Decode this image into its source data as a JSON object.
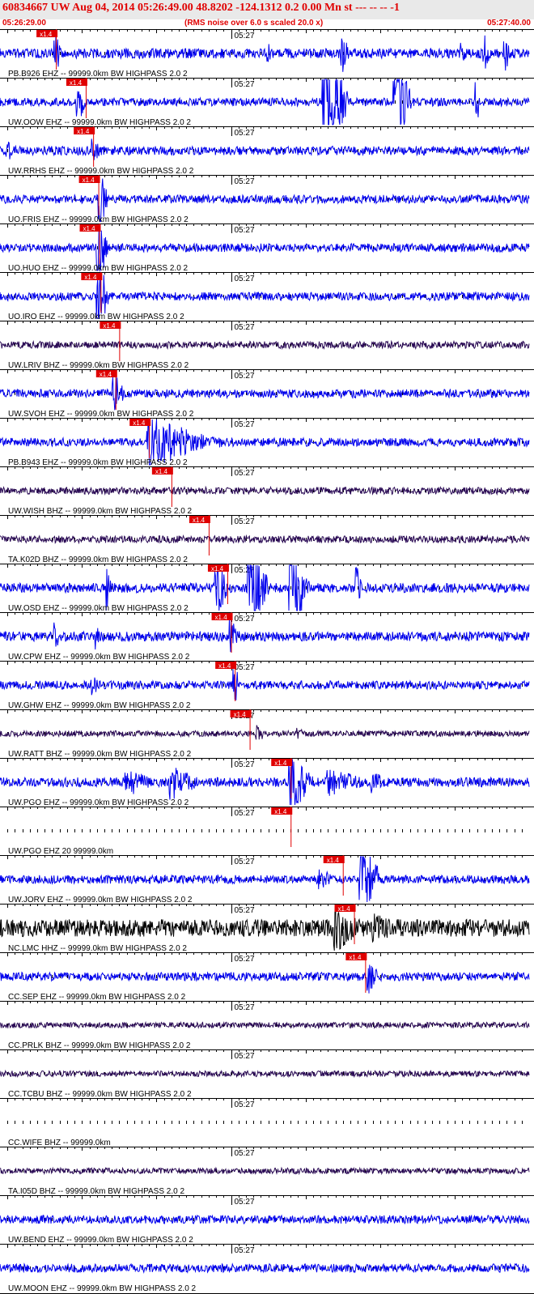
{
  "header": {
    "title": "60834667 UW Aug 04, 2014 05:26:49.00   48.8202 -124.1312  0.2 0.00 Mn st --- -- --  -1",
    "start_time": "05:26:29.00",
    "noise_note": "(RMS noise over 6.0 s scaled 20.0 x)",
    "end_time": "05:27:40.00"
  },
  "chart_data": {
    "type": "line",
    "title": "60834667 UW Aug 04, 2014 05:26:49.00   48.8202 -124.1312  0.2 0.00 Mn st --- -- --  -1",
    "x_range": [
      "05:26:29.00",
      "05:27:40.00"
    ],
    "tick_label": "05:27",
    "pick_label": "x1.4",
    "colors": {
      "trace_blue": "#0000ee",
      "trace_purple": "#2a0a55",
      "trace_black": "#000000",
      "pick": "#e00000",
      "title": "#e00000"
    },
    "traces": [
      {
        "label": "PB.B926 EHZ -- 99999.0km BW  HIGHPASS  2.0  2",
        "color": "#0000ee",
        "pick": 7.5,
        "amp": 0.35,
        "noise": 0.15,
        "bursts": [
          [
            7.5,
            0.8,
            1.0
          ],
          [
            36,
            0.8,
            0.5
          ],
          [
            46,
            1,
            0.9
          ],
          [
            62,
            0.8,
            0.7
          ],
          [
            65,
            0.8,
            1.0
          ],
          [
            67.8,
            0.8,
            0.9
          ]
        ]
      },
      {
        "label": "UW.OOW EHZ -- 99999.0km BW  HIGHPASS  2.0  2",
        "color": "#0000ee",
        "pick": 11.5,
        "amp": 0.3,
        "noise": 0.12,
        "bursts": [
          [
            10.5,
            1.2,
            1.0
          ],
          [
            43.5,
            3.3,
            3.0
          ],
          [
            53,
            2.2,
            2.5
          ],
          [
            64,
            0.5,
            1.0
          ]
        ]
      },
      {
        "label": "UW.RRHS EHZ -- 99999.0km BW  HIGHPASS  2.0  2",
        "color": "#0000ee",
        "pick": 12.5,
        "amp": 0.25,
        "noise": 0.15,
        "bursts": [
          [
            1,
            0.6,
            0.8
          ],
          [
            12.5,
            1.2,
            0.6
          ]
        ]
      },
      {
        "label": "UO.FRIS EHZ -- 99999.0km BW  HIGHPASS  2.0  2",
        "color": "#0000ee",
        "pick": 13.2,
        "amp": 0.2,
        "noise": 0.15,
        "bursts": [
          [
            13.2,
            1.2,
            1.8
          ]
        ]
      },
      {
        "label": "UO.HUO EHZ -- 99999.0km BW  HIGHPASS  2.0  2",
        "color": "#0000ee",
        "pick": 13.3,
        "amp": 0.2,
        "noise": 0.15,
        "bursts": [
          [
            13.2,
            1.3,
            1.8
          ]
        ]
      },
      {
        "label": "UO.IRO EHZ -- 99999.0km BW  HIGHPASS  2.0  2",
        "color": "#0000ee",
        "pick": 13.5,
        "amp": 0.2,
        "noise": 0.15,
        "bursts": [
          [
            13.1,
            1.5,
            1.9
          ]
        ]
      },
      {
        "label": "UW.LRIV BHZ -- 99999.0km BW  HIGHPASS  2.0  2",
        "color": "#2a0a55",
        "pick": 16.0,
        "amp": 0.2,
        "noise": 0.12,
        "bursts": []
      },
      {
        "label": "UW.SVOH EHZ -- 99999.0km BW  HIGHPASS  2.0  2",
        "color": "#0000ee",
        "pick": 15.5,
        "amp": 0.2,
        "noise": 0.15,
        "bursts": [
          [
            15.3,
            1.5,
            1.0
          ]
        ]
      },
      {
        "label": "PB.B943 EHZ -- 99999.0km BW  HIGHPASS  2.0  2",
        "color": "#0000ee",
        "pick": 20.0,
        "amp": 0.2,
        "noise": 0.15,
        "bursts": [
          [
            20,
            7,
            1.5
          ],
          [
            25,
            8,
            0.5
          ]
        ]
      },
      {
        "label": "UW.WISH BHZ -- 99999.0km BW  HIGHPASS  2.0  2",
        "color": "#2a0a55",
        "pick": 23.0,
        "amp": 0.2,
        "noise": 0.12,
        "bursts": []
      },
      {
        "label": "TA.K02D BHZ -- 99999.0km BW  HIGHPASS  2.0  2",
        "color": "#2a0a55",
        "pick": 28.0,
        "amp": 0.2,
        "noise": 0.12,
        "bursts": []
      },
      {
        "label": "UW.OSD EHZ -- 99999.0km BW  HIGHPASS  2.0  2",
        "color": "#0000ee",
        "pick": 30.5,
        "amp": 0.3,
        "noise": 0.15,
        "bursts": [
          [
            14.5,
            0.4,
            1.5
          ],
          [
            29,
            1.6,
            1.5
          ],
          [
            33.5,
            2.5,
            3.0
          ],
          [
            39,
            2.5,
            2.5
          ],
          [
            48,
            0.7,
            1.0
          ]
        ]
      },
      {
        "label": "UW.CPW EHZ -- 99999.0km BW  HIGHPASS  2.0  2",
        "color": "#0000ee",
        "pick": 31.0,
        "amp": 0.3,
        "noise": 0.15,
        "bursts": [
          [
            7.5,
            0.6,
            0.7
          ],
          [
            13,
            0.6,
            0.7
          ],
          [
            31,
            1.2,
            1.0
          ]
        ]
      },
      {
        "label": "UW.GHW EHZ -- 99999.0km BW  HIGHPASS  2.0  2",
        "color": "#0000ee",
        "pick": 31.5,
        "amp": 0.2,
        "noise": 0.15,
        "bursts": [
          [
            12.5,
            1.2,
            0.5
          ],
          [
            31.5,
            0.8,
            1.0
          ]
        ]
      },
      {
        "label": "UW.RATT BHZ -- 99999.0km BW  HIGHPASS  2.0  2",
        "color": "#2a0a55",
        "pick": 33.5,
        "amp": 0.15,
        "noise": 0.1,
        "bursts": [
          [
            34.5,
            1.2,
            0.5
          ],
          [
            40,
            0.8,
            0.4
          ]
        ]
      },
      {
        "label": "UW.PGO EHZ -- 99999.0km BW  HIGHPASS  2.0  2",
        "color": "#0000ee",
        "pick": 39.0,
        "amp": 0.3,
        "noise": 0.15,
        "bursts": [
          [
            17,
            4,
            0.7
          ],
          [
            23,
            4,
            0.9
          ],
          [
            39,
            3,
            1.5
          ],
          [
            44,
            6,
            0.7
          ],
          [
            50,
            2,
            0.6
          ]
        ]
      },
      {
        "label": "UW.PGO EHZ 20 99999.0km",
        "color": "#0000ee",
        "pick": 39.0,
        "amp": 0.0,
        "noise": 0.0,
        "bursts": []
      },
      {
        "label": "UW.JORV EHZ -- 99999.0km BW  HIGHPASS  2.0  2",
        "color": "#0000ee",
        "pick": 46.0,
        "amp": 0.2,
        "noise": 0.15,
        "bursts": [
          [
            43,
            3,
            0.5
          ],
          [
            48.5,
            2.5,
            2.5
          ]
        ]
      },
      {
        "label": "NC.LMC HHZ -- 99999.0km BW  HIGHPASS  2.0  2",
        "color": "#000000",
        "pick": 47.5,
        "amp": 0.45,
        "noise": 0.3,
        "bursts": [
          [
            45,
            4,
            1.2
          ],
          [
            50,
            4,
            0.8
          ]
        ]
      },
      {
        "label": "CC.SEP EHZ -- 99999.0km BW  HIGHPASS  2.0  2",
        "color": "#0000ee",
        "pick": 49.0,
        "amp": 0.2,
        "noise": 0.15,
        "bursts": [
          [
            49.5,
            1.5,
            0.8
          ]
        ]
      },
      {
        "label": "CC.PRLK BHZ -- 99999.0km BW  HIGHPASS  2.0  2",
        "color": "#2a0a55",
        "pick": null,
        "amp": 0.15,
        "noise": 0.1,
        "bursts": []
      },
      {
        "label": "CC.TCBU BHZ -- 99999.0km BW  HIGHPASS  2.0  2",
        "color": "#2a0a55",
        "pick": null,
        "amp": 0.15,
        "noise": 0.1,
        "bursts": []
      },
      {
        "label": "CC.WIFE BHZ -- 99999.0km",
        "color": "#2a0a55",
        "pick": null,
        "amp": 0.0,
        "noise": 0.0,
        "bursts": []
      },
      {
        "label": "TA.I05D BHZ -- 99999.0km BW  HIGHPASS  2.0  2",
        "color": "#2a0a55",
        "pick": null,
        "amp": 0.15,
        "noise": 0.1,
        "bursts": []
      },
      {
        "label": "UW.BEND EHZ -- 99999.0km BW  HIGHPASS  2.0  2",
        "color": "#0000ee",
        "pick": null,
        "amp": 0.2,
        "noise": 0.15,
        "bursts": []
      },
      {
        "label": "UW.MOON EHZ -- 99999.0km BW  HIGHPASS  2.0  2",
        "color": "#0000ee",
        "pick": null,
        "amp": 0.2,
        "noise": 0.15,
        "bursts": []
      }
    ]
  }
}
